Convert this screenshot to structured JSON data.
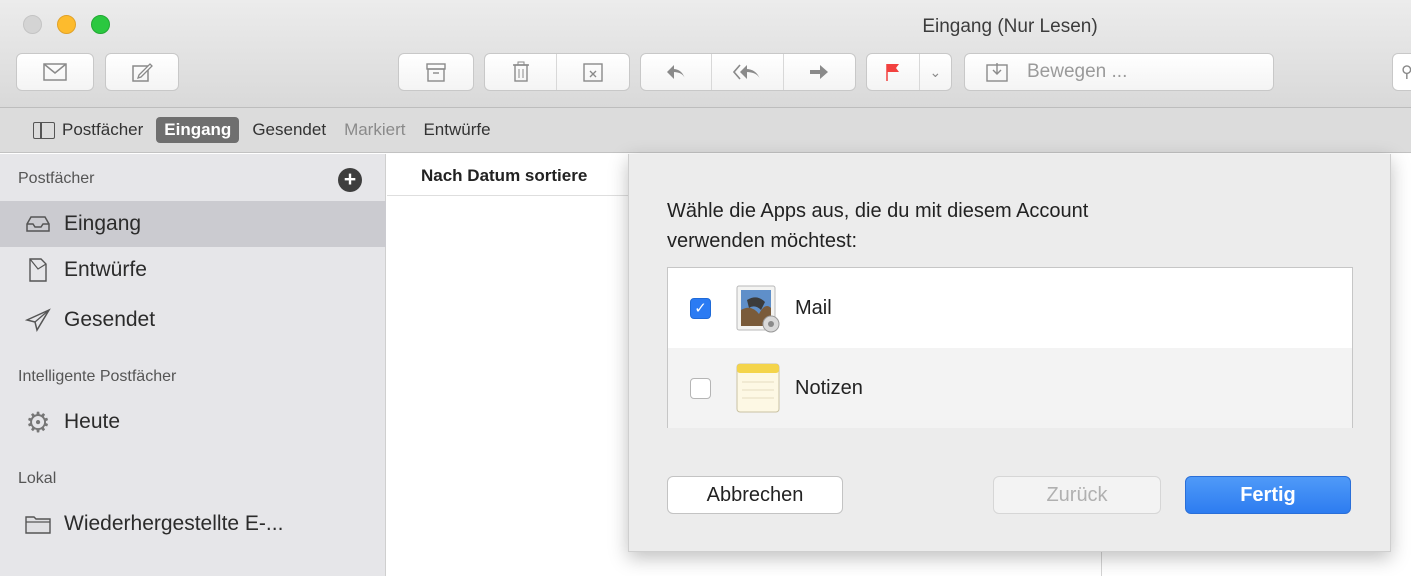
{
  "window": {
    "title": "Eingang (Nur Lesen)"
  },
  "toolbar": {
    "buttons": [
      {
        "name": "get-mail",
        "icon": "envelope-icon"
      },
      {
        "name": "compose",
        "icon": "compose-icon"
      },
      {
        "name": "archive",
        "icon": "archive-icon"
      },
      {
        "name": "trash",
        "icon": "trash-icon"
      },
      {
        "name": "junk",
        "icon": "junk-icon"
      },
      {
        "name": "reply",
        "icon": "reply-icon"
      },
      {
        "name": "reply-all",
        "icon": "reply-all-icon"
      },
      {
        "name": "forward",
        "icon": "forward-icon"
      },
      {
        "name": "flag",
        "icon": "flag-icon"
      },
      {
        "name": "flag-menu",
        "icon": "chevron-down-icon"
      }
    ],
    "move_label": "Bewegen ...",
    "flag_color": "#f2413f"
  },
  "favorites": {
    "postfaecher": "Postfächer",
    "eingang": "Eingang",
    "gesendet": "Gesendet",
    "markiert": "Markiert",
    "entwuerfe": "Entwürfe"
  },
  "sidebar": {
    "mailboxes_header": "Postfächer",
    "items": [
      {
        "label": "Eingang",
        "icon": "inbox-icon",
        "selected": true
      },
      {
        "label": "Entwürfe",
        "icon": "drafts-icon"
      },
      {
        "label": "Gesendet",
        "icon": "sent-icon"
      }
    ],
    "smart_header": "Intelligente Postfächer",
    "smart_items": [
      {
        "label": "Heute",
        "icon": "gear-icon"
      }
    ],
    "local_header": "Lokal",
    "local_items": [
      {
        "label": "Wiederhergestellte E-...",
        "icon": "folder-icon"
      }
    ]
  },
  "message_list": {
    "sort_label": "Nach Datum sortiere"
  },
  "sheet": {
    "prompt_line1": "Wähle die Apps aus, die du mit diesem Account",
    "prompt_line2": "verwenden möchtest:",
    "apps": [
      {
        "label": "Mail",
        "checked": true,
        "icon": "mail-app-icon"
      },
      {
        "label": "Notizen",
        "checked": false,
        "icon": "notes-app-icon"
      }
    ],
    "cancel_label": "Abbrechen",
    "back_label": "Zurück",
    "done_label": "Fertig"
  },
  "colors": {
    "accent": "#2d7cf0",
    "sidebar_bg": "#e6e6e9",
    "selection": "#cbcbd0"
  }
}
